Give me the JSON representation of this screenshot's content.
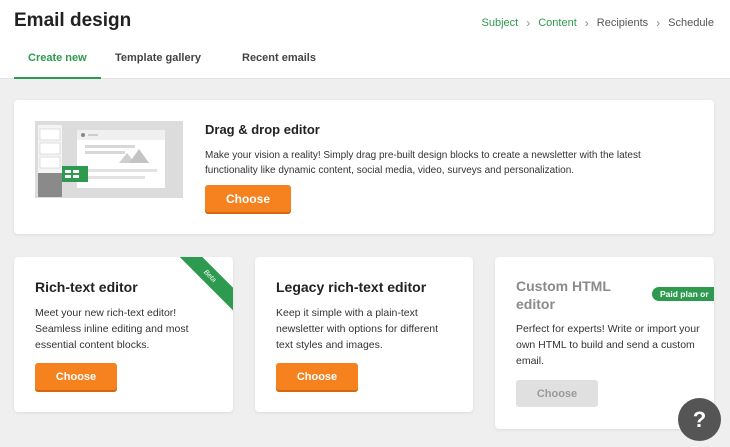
{
  "header": {
    "title": "Email design",
    "steps": [
      {
        "label": "Subject",
        "state": "done"
      },
      {
        "label": "Content",
        "state": "current"
      },
      {
        "label": "Recipients",
        "state": "upcoming"
      },
      {
        "label": "Schedule",
        "state": "upcoming"
      }
    ]
  },
  "tabs": [
    {
      "label": "Create new",
      "active": true
    },
    {
      "label": "Template gallery",
      "active": false
    },
    {
      "label": "Recent emails",
      "active": false
    }
  ],
  "editors": {
    "drag_drop": {
      "title": "Drag & drop editor",
      "description": "Make your vision a reality! Simply drag pre-built design blocks to create a newsletter with the latest functionality like dynamic content, social media, video, surveys and personalization.",
      "button": "Choose"
    },
    "rich_text": {
      "title": "Rich-text editor",
      "badge": "Beta",
      "description": "Meet your new rich-text editor! Seamless inline editing and most essential content blocks.",
      "button": "Choose"
    },
    "legacy": {
      "title": "Legacy rich-text editor",
      "description": "Keep it simple with a plain-text newsletter with options for different text styles and images.",
      "button": "Choose"
    },
    "custom_html": {
      "title": "Custom HTML editor",
      "badge": "Paid plan or",
      "description": "Perfect for experts! Write or import your own HTML to build and send a custom email.",
      "button": "Choose",
      "disabled": true
    }
  },
  "help": {
    "label": "?"
  },
  "colors": {
    "accent": "#2e9a4f",
    "button": "#f5821f",
    "background": "#efefef"
  }
}
